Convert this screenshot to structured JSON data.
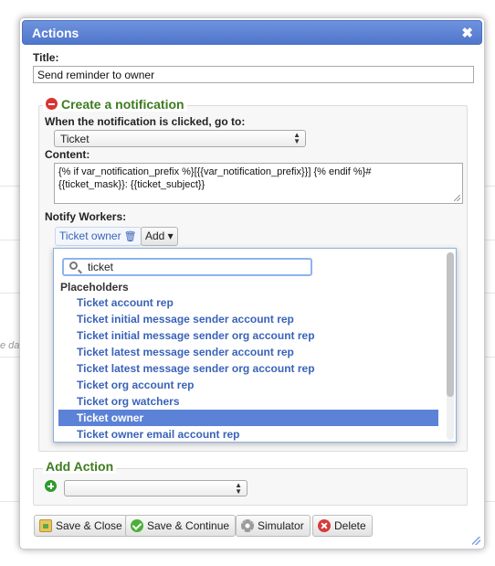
{
  "dialog": {
    "title": "Actions",
    "close_glyph": "✖"
  },
  "title_field": {
    "label": "Title:",
    "value": "Send reminder to owner"
  },
  "notification": {
    "legend": "Create a notification",
    "click_label": "When the notification is clicked, go to:",
    "click_value": "Ticket",
    "content_label": "Content:",
    "content_line1": "{% if var_notification_prefix %}[{{var_notification_prefix}}] {% endif %}#",
    "content_line2": "{{ticket_mask}}: {{ticket_subject}}",
    "notify_label": "Notify Workers:",
    "worker_chip": "Ticket owner",
    "add_button": "Add ▾"
  },
  "popup": {
    "search_value": "ticket",
    "group_label": "Placeholders",
    "items": [
      "Ticket account rep",
      "Ticket initial message sender account rep",
      "Ticket initial message sender org account rep",
      "Ticket latest message sender account rep",
      "Ticket latest message sender org account rep",
      "Ticket org account rep",
      "Ticket org watchers",
      "Ticket owner",
      "Ticket owner email account rep"
    ],
    "selected": "Ticket owner"
  },
  "add_action": {
    "legend": "Add Action",
    "select_value": ""
  },
  "buttons": {
    "save_close": "Save & Close",
    "save_continue": "Save & Continue",
    "simulator": "Simulator",
    "delete": "Delete"
  },
  "background": {
    "fragment": "e da"
  },
  "icons": [
    "close-icon",
    "remove-icon",
    "trash-icon",
    "search-icon",
    "add-icon",
    "folder-icon",
    "check-icon",
    "gear-icon",
    "delete-icon"
  ],
  "colors": {
    "titlebar": "#5b82d6",
    "legend_green": "#3d7c1f",
    "link_blue": "#3a63b8",
    "selected_row": "#5b82d6"
  }
}
